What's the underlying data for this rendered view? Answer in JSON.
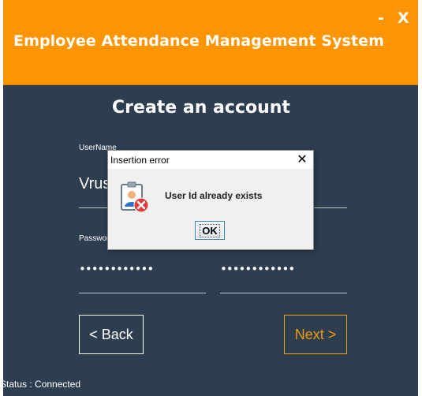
{
  "header": {
    "title": "Employee Attendance Management System",
    "minimize_label": "-",
    "close_label": "X",
    "color": "#fb9505"
  },
  "form": {
    "title": "Create an account",
    "username_label": "UserName",
    "username_value": "Vrusl",
    "password_label": "Password",
    "password_dots": "••••••••••••",
    "confirm_password_dots": "••••••••••••",
    "background": "#2d3e50"
  },
  "buttons": {
    "back_label": "< Back",
    "next_label": "Next >"
  },
  "status": {
    "text": "Status : Connected"
  },
  "dialog": {
    "title": "Insertion error",
    "close_label": "✕",
    "message": "User Id already exists",
    "ok_label": "OK",
    "icon": "user-error-icon"
  }
}
